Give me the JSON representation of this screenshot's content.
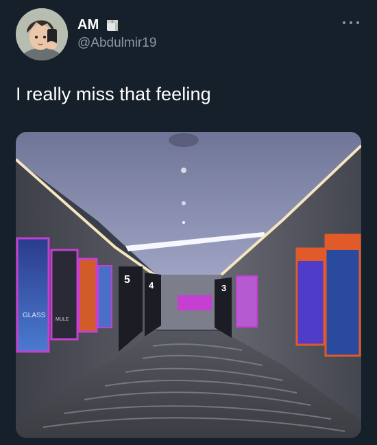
{
  "author": {
    "display_name": "AM",
    "handle": "@Abdulmir19",
    "avatar_icon": "anime-avatar",
    "badge_icon": "toilet-paper-emoji"
  },
  "tweet": {
    "text": "I really miss that feeling"
  },
  "menu": {
    "icon": "more-horizontal-icon"
  },
  "media": {
    "description_icon": "cinema-hallway-photo",
    "screen_numbers": [
      "5",
      "4",
      "3"
    ],
    "posters_left": [
      "GLASS",
      "MULE"
    ]
  },
  "colors": {
    "background": "#15202b",
    "secondary_text": "#8b98a5",
    "primary_text": "#ffffff"
  }
}
